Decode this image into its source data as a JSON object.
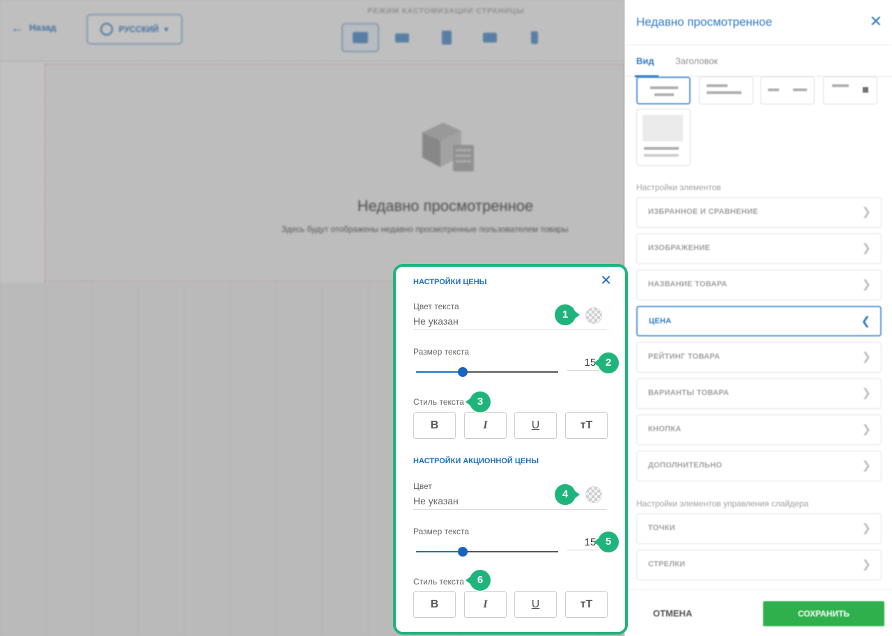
{
  "topbar": {
    "back_label": "Назад",
    "language_label": "РУССКИЙ",
    "mode_title": "РЕЖИМ КАСТОМИЗАЦИИ СТРАНИЦЫ",
    "devices": [
      "desktop-icon",
      "laptop-icon",
      "tablet-icon",
      "tablet-landscape-icon",
      "mobile-icon"
    ]
  },
  "canvas": {
    "title": "Недавно просмотренное",
    "subtitle": "Здесь будут отображены недавно просмотренные пользователем товары"
  },
  "panel": {
    "title": "Недавно просмотренное",
    "tabs": [
      {
        "label": "Вид",
        "active": true
      },
      {
        "label": "Заголовок",
        "active": false
      }
    ],
    "elements_label": "Настройки элементов",
    "elements": [
      {
        "label": "ИЗБРАННОЕ И СРАВНЕНИЕ",
        "active": false
      },
      {
        "label": "ИЗОБРАЖЕНИЕ",
        "active": false
      },
      {
        "label": "НАЗВАНИЕ ТОВАРА",
        "active": false
      },
      {
        "label": "ЦЕНА",
        "active": true
      },
      {
        "label": "РЕЙТИНГ ТОВАРА",
        "active": false
      },
      {
        "label": "ВАРИАНТЫ ТОВАРА",
        "active": false
      },
      {
        "label": "КНОПКА",
        "active": false
      },
      {
        "label": "ДОПОЛНИТЕЛЬНО",
        "active": false
      }
    ],
    "slider_label": "Настройки элементов управления слайдера",
    "slider_elements": [
      {
        "label": "ТОЧКИ"
      },
      {
        "label": "СТРЕЛКИ"
      }
    ],
    "cancel_label": "ОТМЕНА",
    "save_label": "СОХРАНИТЬ"
  },
  "popup": {
    "price_heading": "НАСТРОЙКИ ЦЕНЫ",
    "price": {
      "color_label": "Цвет текста",
      "color_value": "Не указан",
      "size_label": "Размер текста",
      "size_value": "15",
      "size_fraction": 0.33,
      "style_label": "Стиль текста"
    },
    "promo_heading": "НАСТРОЙКИ АКЦИОННОЙ ЦЕНЫ",
    "promo": {
      "color_label": "Цвет",
      "color_value": "Не указан",
      "size_label": "Размер текста",
      "size_value": "15",
      "size_fraction": 0.33,
      "style_label": "Стиль текста"
    },
    "style_buttons": [
      "B",
      "I",
      "U",
      "тT"
    ]
  },
  "callouts": [
    "1",
    "2",
    "3",
    "4",
    "5",
    "6"
  ],
  "colors": {
    "accent": "#1f6fbf",
    "highlight": "#20b47d",
    "save": "#1faa3e"
  }
}
